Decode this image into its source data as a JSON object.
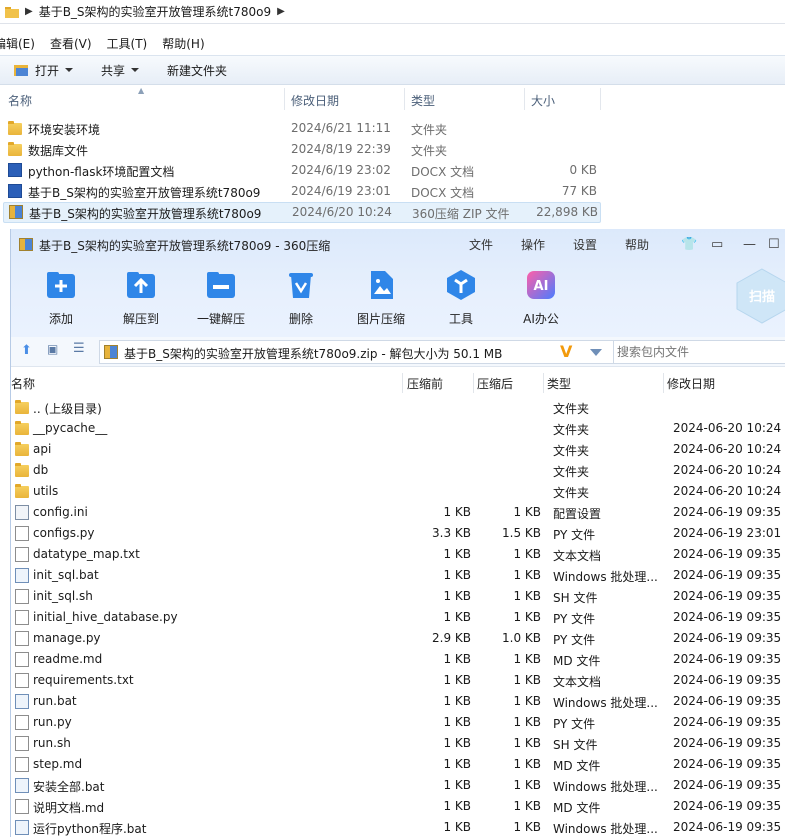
{
  "explorer": {
    "breadcrumb": "基于B_S架构的实验室开放管理系统t780o9",
    "menu": [
      "编辑(E)",
      "查看(V)",
      "工具(T)",
      "帮助(H)"
    ],
    "toolbar": {
      "open": "打开",
      "share": "共享",
      "new_folder": "新建文件夹"
    },
    "columns": {
      "name": "名称",
      "modified": "修改日期",
      "type": "类型",
      "size": "大小"
    },
    "rows": [
      {
        "icon": "folder-icon",
        "name": "环境安装环境",
        "modified": "2024/6/21 11:11",
        "type": "文件夹",
        "size": ""
      },
      {
        "icon": "folder-icon",
        "name": "数据库文件",
        "modified": "2024/8/19 22:39",
        "type": "文件夹",
        "size": ""
      },
      {
        "icon": "word-doc-icon",
        "name": "python-flask环境配置文档",
        "modified": "2024/6/19 23:02",
        "type": "DOCX 文档",
        "size": "0 KB"
      },
      {
        "icon": "word-doc-icon",
        "name": "基于B_S架构的实验室开放管理系统t780o9",
        "modified": "2024/6/19 23:01",
        "type": "DOCX 文档",
        "size": "77 KB"
      },
      {
        "icon": "zip-archive-icon",
        "name": "基于B_S架构的实验室开放管理系统t780o9",
        "modified": "2024/6/20 10:24",
        "type": "360压缩 ZIP 文件",
        "size": "22,898 KB"
      }
    ]
  },
  "zipwin": {
    "title": "基于B_S架构的实验室开放管理系统t780o9 - 360压缩",
    "menu": [
      "文件",
      "操作",
      "设置",
      "帮助"
    ],
    "tools": [
      {
        "label": "添加",
        "icon": "add-icon",
        "color": "#2f86e8"
      },
      {
        "label": "解压到",
        "icon": "extract-to-icon",
        "color": "#2f86e8"
      },
      {
        "label": "一键解压",
        "icon": "one-click-extract-icon",
        "color": "#2f86e8"
      },
      {
        "label": "删除",
        "icon": "delete-icon",
        "color": "#2f86e8"
      },
      {
        "label": "图片压缩",
        "icon": "image-compress-icon",
        "color": "#2f86e8"
      },
      {
        "label": "工具",
        "icon": "tools-icon",
        "color": "#2f86e8"
      },
      {
        "label": "AI办公",
        "icon": "ai-office-icon",
        "color": "#b04df0"
      }
    ],
    "scan_label": "扫描",
    "path_text": "基于B_S架构的实验室开放管理系统t780o9.zip - 解包大小为 50.1 MB",
    "search_placeholder": "搜索包内文件",
    "columns": {
      "name": "名称",
      "packed": "压缩前",
      "compressed": "压缩后",
      "type": "类型",
      "modified": "修改日期"
    },
    "rows": [
      {
        "icon": "folder-icon",
        "name": ".. (上级目录)",
        "packed": "",
        "compressed": "",
        "type": "文件夹",
        "modified": ""
      },
      {
        "icon": "folder-icon",
        "name": "__pycache__",
        "packed": "",
        "compressed": "",
        "type": "文件夹",
        "modified": "2024-06-20 10:24"
      },
      {
        "icon": "folder-icon",
        "name": "api",
        "packed": "",
        "compressed": "",
        "type": "文件夹",
        "modified": "2024-06-20 10:24"
      },
      {
        "icon": "folder-icon",
        "name": "db",
        "packed": "",
        "compressed": "",
        "type": "文件夹",
        "modified": "2024-06-20 10:24"
      },
      {
        "icon": "folder-icon",
        "name": "utils",
        "packed": "",
        "compressed": "",
        "type": "文件夹",
        "modified": "2024-06-20 10:24"
      },
      {
        "icon": "config-file-icon",
        "name": "config.ini",
        "packed": "1 KB",
        "compressed": "1 KB",
        "type": "配置设置",
        "modified": "2024-06-19 09:35"
      },
      {
        "icon": "file-icon",
        "name": "configs.py",
        "packed": "3.3 KB",
        "compressed": "1.5 KB",
        "type": "PY 文件",
        "modified": "2024-06-19 23:01"
      },
      {
        "icon": "file-icon",
        "name": "datatype_map.txt",
        "packed": "1 KB",
        "compressed": "1 KB",
        "type": "文本文档",
        "modified": "2024-06-19 09:35"
      },
      {
        "icon": "batch-file-icon",
        "name": "init_sql.bat",
        "packed": "1 KB",
        "compressed": "1 KB",
        "type": "Windows 批处理...",
        "modified": "2024-06-19 09:35"
      },
      {
        "icon": "file-icon",
        "name": "init_sql.sh",
        "packed": "1 KB",
        "compressed": "1 KB",
        "type": "SH 文件",
        "modified": "2024-06-19 09:35"
      },
      {
        "icon": "file-icon",
        "name": "initial_hive_database.py",
        "packed": "1 KB",
        "compressed": "1 KB",
        "type": "PY 文件",
        "modified": "2024-06-19 09:35"
      },
      {
        "icon": "file-icon",
        "name": "manage.py",
        "packed": "2.9 KB",
        "compressed": "1.0 KB",
        "type": "PY 文件",
        "modified": "2024-06-19 09:35"
      },
      {
        "icon": "file-icon",
        "name": "readme.md",
        "packed": "1 KB",
        "compressed": "1 KB",
        "type": "MD 文件",
        "modified": "2024-06-19 09:35"
      },
      {
        "icon": "file-icon",
        "name": "requirements.txt",
        "packed": "1 KB",
        "compressed": "1 KB",
        "type": "文本文档",
        "modified": "2024-06-19 09:35"
      },
      {
        "icon": "batch-file-icon",
        "name": "run.bat",
        "packed": "1 KB",
        "compressed": "1 KB",
        "type": "Windows 批处理...",
        "modified": "2024-06-19 09:35"
      },
      {
        "icon": "file-icon",
        "name": "run.py",
        "packed": "1 KB",
        "compressed": "1 KB",
        "type": "PY 文件",
        "modified": "2024-06-19 09:35"
      },
      {
        "icon": "file-icon",
        "name": "run.sh",
        "packed": "1 KB",
        "compressed": "1 KB",
        "type": "SH 文件",
        "modified": "2024-06-19 09:35"
      },
      {
        "icon": "file-icon",
        "name": "step.md",
        "packed": "1 KB",
        "compressed": "1 KB",
        "type": "MD 文件",
        "modified": "2024-06-19 09:35"
      },
      {
        "icon": "batch-file-icon",
        "name": "安装全部.bat",
        "packed": "1 KB",
        "compressed": "1 KB",
        "type": "Windows 批处理...",
        "modified": "2024-06-19 09:35"
      },
      {
        "icon": "file-icon",
        "name": "说明文档.md",
        "packed": "1 KB",
        "compressed": "1 KB",
        "type": "MD 文件",
        "modified": "2024-06-19 09:35"
      },
      {
        "icon": "batch-file-icon",
        "name": "运行python程序.bat",
        "packed": "1 KB",
        "compressed": "1 KB",
        "type": "Windows 批处理...",
        "modified": "2024-06-19 09:35"
      }
    ]
  }
}
